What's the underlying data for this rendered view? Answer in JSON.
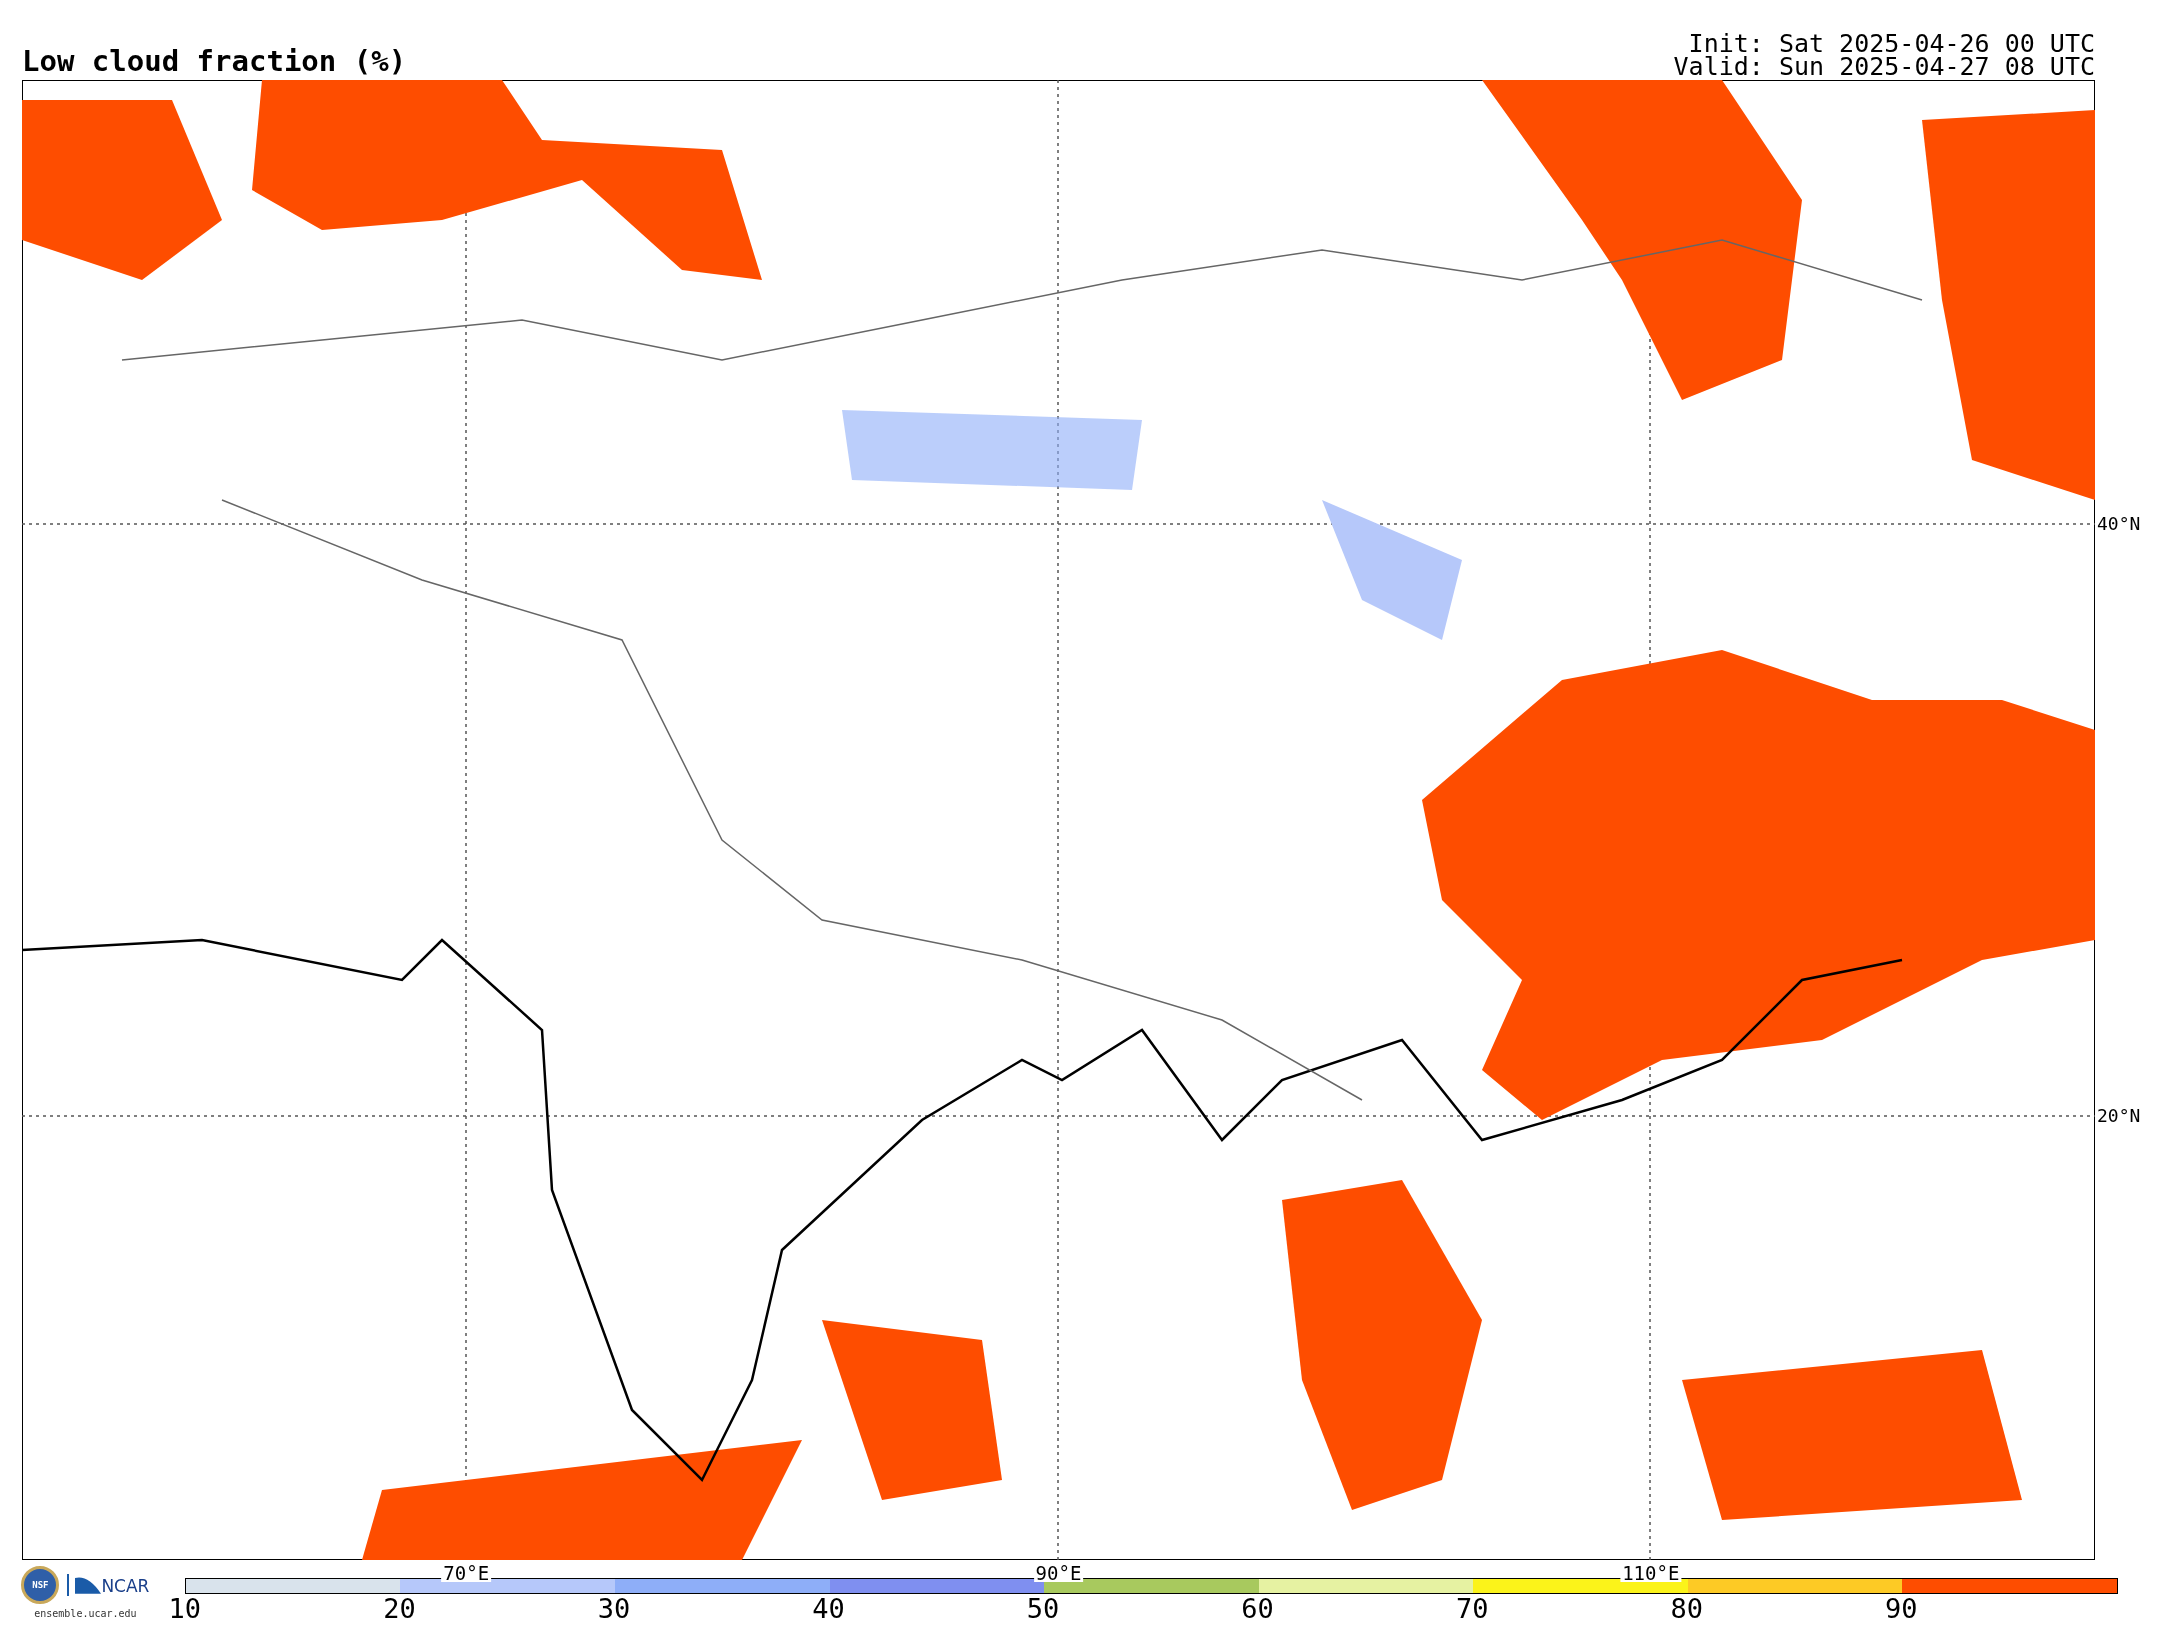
{
  "title": "Low cloud fraction (%)",
  "init": "Init: Sat 2025-04-26 00 UTC",
  "valid": "Valid: Sun 2025-04-27 08 UTC",
  "lat_labels": [
    {
      "label": "40°N"
    },
    {
      "label": "20°N"
    }
  ],
  "lon_labels": [
    {
      "label": "70°E"
    },
    {
      "label": "90°E"
    },
    {
      "label": "110°E"
    }
  ],
  "logo": {
    "badge": "NSF",
    "org": "NCAR",
    "url": "ensemble.ucar.edu"
  },
  "colorbar": {
    "segments": [
      {
        "color": "#d9e3ec",
        "label": "10"
      },
      {
        "color": "#b6c8fa",
        "label": "20"
      },
      {
        "color": "#8eaef8",
        "label": "30"
      },
      {
        "color": "#7f8ff0",
        "label": "40"
      },
      {
        "color": "#a8c95e",
        "label": "50"
      },
      {
        "color": "#e6f2a2",
        "label": "60"
      },
      {
        "color": "#fbf31a",
        "label": "70"
      },
      {
        "color": "#fdca25",
        "label": "80"
      },
      {
        "color": "#fe4d00",
        "label": "90"
      }
    ]
  }
}
